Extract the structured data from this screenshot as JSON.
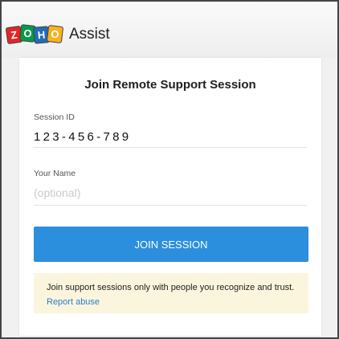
{
  "header": {
    "logo_letters": [
      "Z",
      "O",
      "H",
      "O"
    ],
    "product_name": "Assist"
  },
  "form": {
    "title": "Join Remote Support Session",
    "session_id_label": "Session ID",
    "session_id_value": "123-456-789",
    "name_label": "Your Name",
    "name_placeholder": "(optional)",
    "name_value": "",
    "join_button_label": "JOIN SESSION"
  },
  "notice": {
    "text": "Join support sessions only with people you recognize and trust.",
    "link_label": "Report abuse"
  },
  "colors": {
    "button": "#2b8fdd",
    "notice_background": "#fcf5dd",
    "link": "#2a7dc8"
  }
}
